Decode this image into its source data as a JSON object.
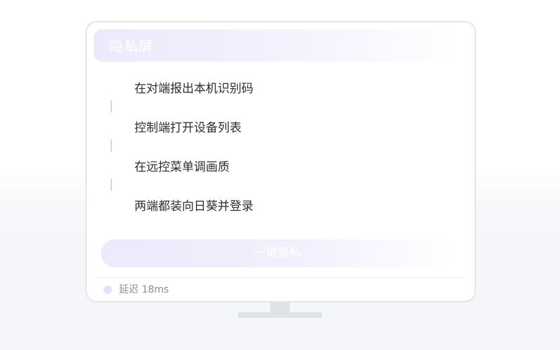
{
  "header": {
    "title": "隐私屏"
  },
  "steps": [
    {
      "label": "在对端报出本机识别码"
    },
    {
      "label": "控制端打开设备列表"
    },
    {
      "label": "在远控菜单调画质"
    },
    {
      "label": "两端都装向日葵并登录"
    }
  ],
  "action": {
    "label": "一键隐私"
  },
  "status": {
    "text": "延迟 18ms"
  },
  "colors": {
    "accent_light": "#ece9fb",
    "text_primary": "#2b2d33",
    "text_muted": "#8a8d96",
    "frame": "#e4e6ea"
  },
  "icons": {
    "status": "status-dot-icon",
    "step_connector": "timeline-connector"
  }
}
